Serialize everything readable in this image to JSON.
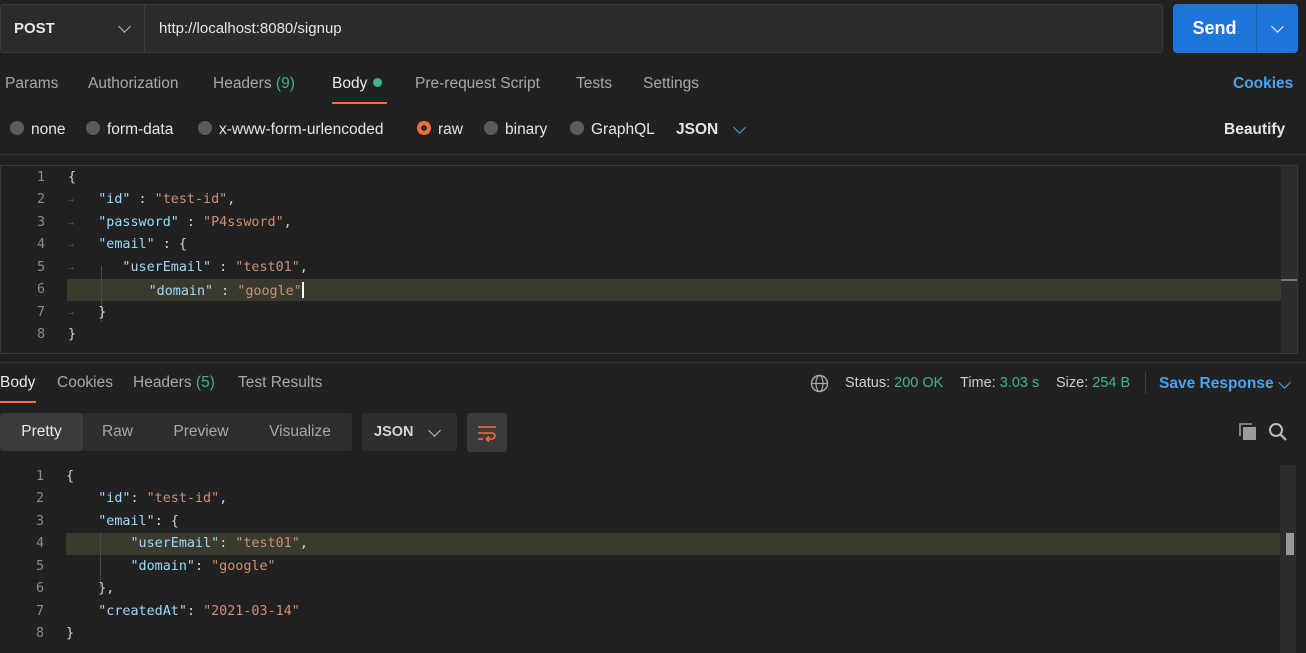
{
  "request": {
    "method": "POST",
    "url": "http://localhost:8080/signup",
    "send_label": "Send"
  },
  "tabs": [
    {
      "label": "Params"
    },
    {
      "label": "Authorization"
    },
    {
      "label": "Headers",
      "count": "(9)"
    },
    {
      "label": "Body"
    },
    {
      "label": "Pre-request Script"
    },
    {
      "label": "Tests"
    },
    {
      "label": "Settings"
    }
  ],
  "cookies_label": "Cookies",
  "body_types": [
    "none",
    "form-data",
    "x-www-form-urlencoded",
    "raw",
    "binary",
    "GraphQL"
  ],
  "selected_body_type": "raw",
  "format": "JSON",
  "beautify_label": "Beautify",
  "request_body": {
    "line_numbers": [
      "1",
      "2",
      "3",
      "4",
      "5",
      "6",
      "7",
      "8"
    ],
    "id_key": "\"id\"",
    "id_val": "\"test-id\"",
    "password_key": "\"password\"",
    "password_val": "\"P4ssword\"",
    "email_key": "\"email\"",
    "userEmail_key": "\"userEmail\"",
    "userEmail_val": "\"test01\"",
    "domain_key": "\"domain\"",
    "domain_val": "\"google\""
  },
  "response": {
    "tabs": [
      {
        "label": "Body"
      },
      {
        "label": "Cookies"
      },
      {
        "label": "Headers",
        "count": "(5)"
      },
      {
        "label": "Test Results"
      }
    ],
    "status_label": "Status:",
    "status_value": "200 OK",
    "time_label": "Time:",
    "time_value": "3.03 s",
    "size_label": "Size:",
    "size_value": "254 B",
    "save_label": "Save Response",
    "views": [
      "Pretty",
      "Raw",
      "Preview",
      "Visualize"
    ],
    "format": "JSON",
    "line_numbers": [
      "1",
      "2",
      "3",
      "4",
      "5",
      "6",
      "7",
      "8"
    ],
    "id_key": "\"id\"",
    "id_val": "\"test-id\"",
    "email_key": "\"email\"",
    "userEmail_key": "\"userEmail\"",
    "userEmail_val": "\"test01\"",
    "domain_key": "\"domain\"",
    "domain_val": "\"google\"",
    "createdAt_key": "\"createdAt\"",
    "createdAt_val": "\"2021-03-14\""
  },
  "colors": {
    "accent": "#ff6c37",
    "send": "#1e74d8",
    "link": "#4aa3f0",
    "success": "#3fb58b"
  }
}
